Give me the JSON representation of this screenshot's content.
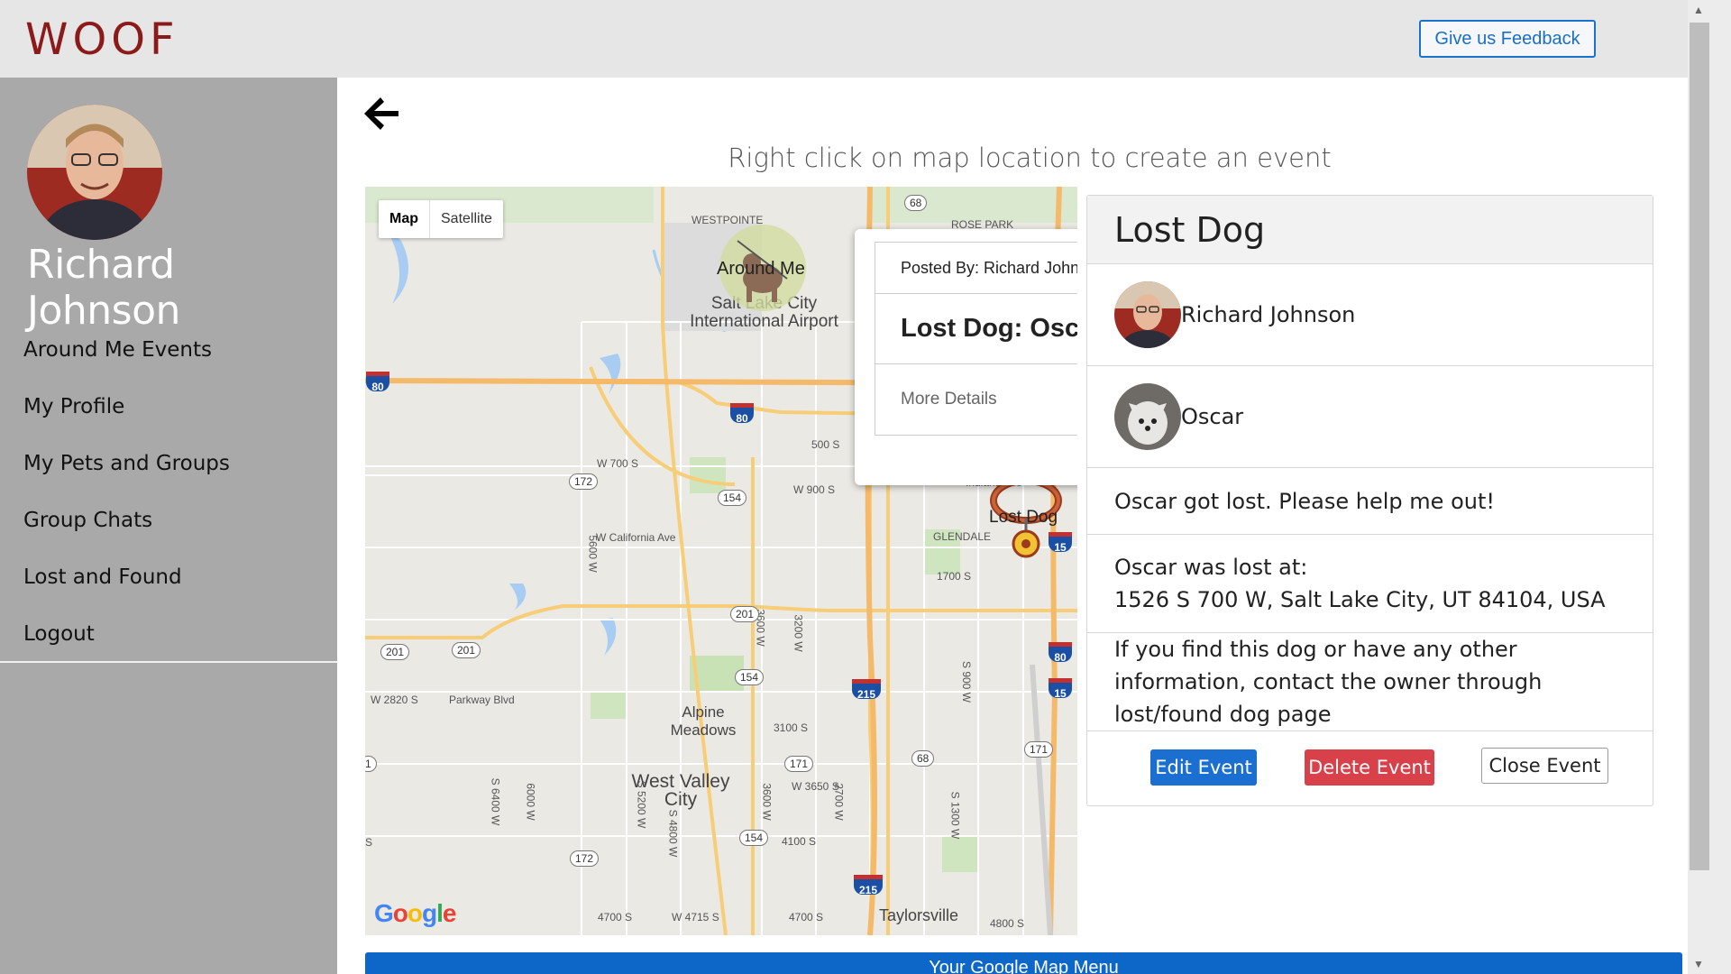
{
  "header": {
    "logo": "WOOF",
    "feedback_label": "Give us Feedback"
  },
  "sidebar": {
    "user_name": "Richard Johnson",
    "items": [
      {
        "label": "Around Me Events"
      },
      {
        "label": "My Profile"
      },
      {
        "label": "My Pets and Groups"
      },
      {
        "label": "Group Chats"
      },
      {
        "label": "Lost and Found"
      },
      {
        "label": "Logout"
      }
    ]
  },
  "main": {
    "instruction": "Right click on map location to create an event"
  },
  "map": {
    "type_options": [
      "Map",
      "Satellite"
    ],
    "selected_type": "Map",
    "around_me_label": "Around Me",
    "lost_marker_label": "Lost Dog",
    "google_label": "Google",
    "place_labels": {
      "westpointe": "WESTPOINTE",
      "rose_park": "ROSE PARK",
      "airport": "Salt Lake City International Airport",
      "w700s": "W 700 S",
      "s500": "500 S",
      "w900s": "W 900 S",
      "indiana": "Indiana Ave",
      "california": "W California Ave",
      "glendale": "GLENDALE",
      "s1700": "1700 S",
      "w2820s": "W 2820 S",
      "parkway": "Parkway Blvd",
      "alpine": "Alpine Meadows",
      "s3100": "3100 S",
      "wvc": "West Valley City",
      "w3650": "W 3650 S",
      "s4100": "4100 S",
      "taylorsville": "Taylorsville",
      "s4700": "4700 S",
      "w4715": "W 4715 S",
      "s4700b": "4700 S",
      "s4800": "4800 S",
      "w5600": "5600 W",
      "w3600": "3600 W",
      "w3200": "3200 W",
      "w900": "S 900 W",
      "w6400": "S 6400 W",
      "w6000": "6000 W",
      "w5200": "S 5200 W",
      "w4800": "S 4800 W",
      "w3600b": "3600 W",
      "w2700": "2700 W",
      "s1300": "S 1300 W",
      "s_edge": "S"
    },
    "shields": {
      "r68a": "68",
      "r172a": "172",
      "r154a": "154",
      "r201a": "201",
      "r201b": "201",
      "r201c": "201",
      "r154b": "154",
      "r171a": "171",
      "r68b": "68",
      "r171b": "171",
      "r154c": "154",
      "r172b": "172",
      "r1edge": "1"
    },
    "interstates": {
      "i80a": "80",
      "i80b": "80",
      "i15a": "15",
      "i80c": "80",
      "i15b": "15",
      "i215a": "215",
      "i215b": "215"
    }
  },
  "info_window": {
    "posted_by": "Posted By: Richard Johnson",
    "title": "Lost Dog: Oscar",
    "more_details": "More Details"
  },
  "event_panel": {
    "title": "Lost Dog",
    "owner_name": "Richard Johnson",
    "pet_name": "Oscar",
    "description": "Oscar got lost. Please help me out!",
    "location_label": "Oscar was lost at:",
    "location_address": "1526 S 700 W, Salt Lake City, UT 84104, USA",
    "contact_note": "If you find this dog or have any other information, contact the owner through lost/found dog page",
    "edit_label": "Edit Event",
    "delete_label": "Delete Event",
    "close_label": "Close Event"
  },
  "bottom_bar": {
    "label": "Your Google Map Menu"
  },
  "colors": {
    "logo": "#8b1a1a",
    "sidebar_bg": "#a9a9a9",
    "primary": "#1b6fd0",
    "danger": "#d9414a",
    "bottom_bar": "#0c67c9"
  }
}
